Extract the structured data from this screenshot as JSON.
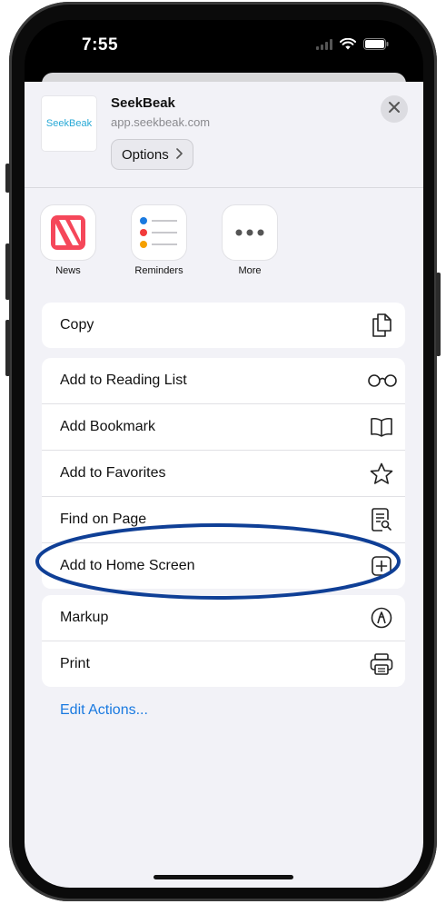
{
  "status_bar": {
    "time": "7:55"
  },
  "share_sheet": {
    "site": {
      "name": "SeekBeak",
      "url": "app.seekbeak.com",
      "thumb_text": "SeekBeak"
    },
    "options_label": "Options",
    "apps": [
      {
        "label": "News",
        "icon": "news-icon"
      },
      {
        "label": "Reminders",
        "icon": "reminders-icon"
      },
      {
        "label": "More",
        "icon": "more-icon"
      }
    ],
    "actions_group1": [
      {
        "label": "Copy",
        "icon": "copy-icon"
      }
    ],
    "actions_group2": [
      {
        "label": "Add to Reading List",
        "icon": "glasses-icon"
      },
      {
        "label": "Add Bookmark",
        "icon": "book-icon"
      },
      {
        "label": "Add to Favorites",
        "icon": "star-icon"
      },
      {
        "label": "Find on Page",
        "icon": "find-doc-icon"
      },
      {
        "label": "Add to Home Screen",
        "icon": "plus-square-icon"
      }
    ],
    "actions_group3": [
      {
        "label": "Markup",
        "icon": "markup-icon"
      },
      {
        "label": "Print",
        "icon": "printer-icon"
      }
    ],
    "edit_actions_label": "Edit Actions..."
  },
  "colors": {
    "accent": "#1a7ae0",
    "highlight_ring": "#0f3f96",
    "news_red": "#f5475a"
  }
}
